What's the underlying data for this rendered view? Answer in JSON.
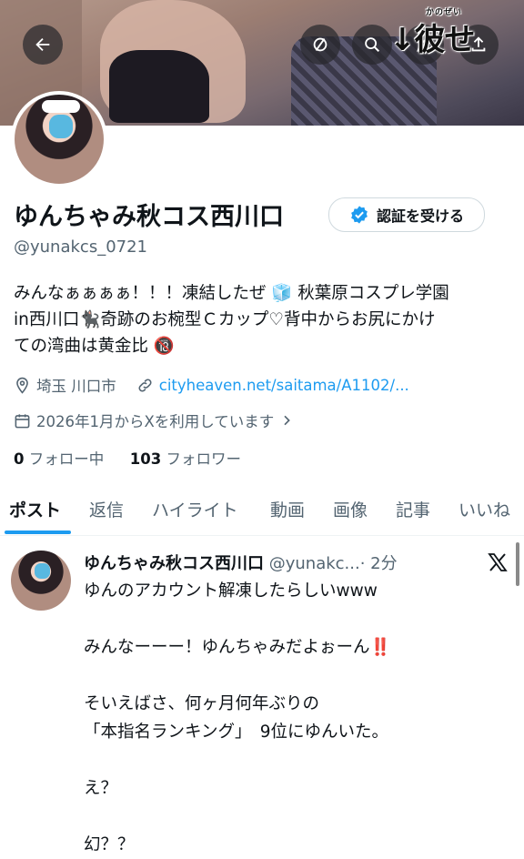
{
  "header": {
    "back_icon": "arrow-left-icon",
    "mute_icon": "slashed-circle-icon",
    "search_icon": "search-icon",
    "share_icon": "upload-icon",
    "overlay_text": "↓彼せ",
    "overlay_ruby": "かのぜい"
  },
  "profile": {
    "name": "ゆんちゃみ秋コス西川口",
    "handle": "@yunakcs_0721",
    "verify_button": "認証を受ける",
    "bio_lines": [
      "みんなぁぁぁぁ！！！凍結したぜ 🧊 秋葉原コスプレ学園",
      "in西川口🐈‍⬛奇跡のお椀型Ｃカップ♡背中からお尻にかけ",
      "ての湾曲は黄金比 🔞"
    ],
    "location": "埼玉 川口市",
    "website": "cityheaven.net/saitama/A1102/...",
    "joined": "2026年1月からXを利用しています",
    "following_count": "0",
    "following_label": "フォロー中",
    "followers_count": "103",
    "followers_label": "フォロワー"
  },
  "tabs": [
    {
      "label": "ポスト",
      "active": true
    },
    {
      "label": "返信"
    },
    {
      "label": "ハイライト"
    },
    {
      "label": "動画"
    },
    {
      "label": "画像"
    },
    {
      "label": "記事"
    },
    {
      "label": "いいね"
    }
  ],
  "post": {
    "author_name": "ゆんちゃみ秋コス西川口",
    "author_handle": "@yunakc...",
    "time": "· 2分",
    "lines": [
      "ゆんのアカウント解凍したらしいwww",
      "",
      "みんなーーー！ゆんちゃみだよぉーん‼️",
      "",
      "そいえばさ、何ヶ月何年ぶりの",
      "「本指名ランキング」　9位にゆんいた。",
      "",
      "え？",
      "",
      "幻？？"
    ]
  },
  "colors": {
    "accent": "#1d9bf0",
    "text_primary": "#0f1419",
    "text_secondary": "#536471",
    "verified_badge": "#1d9bf0"
  }
}
